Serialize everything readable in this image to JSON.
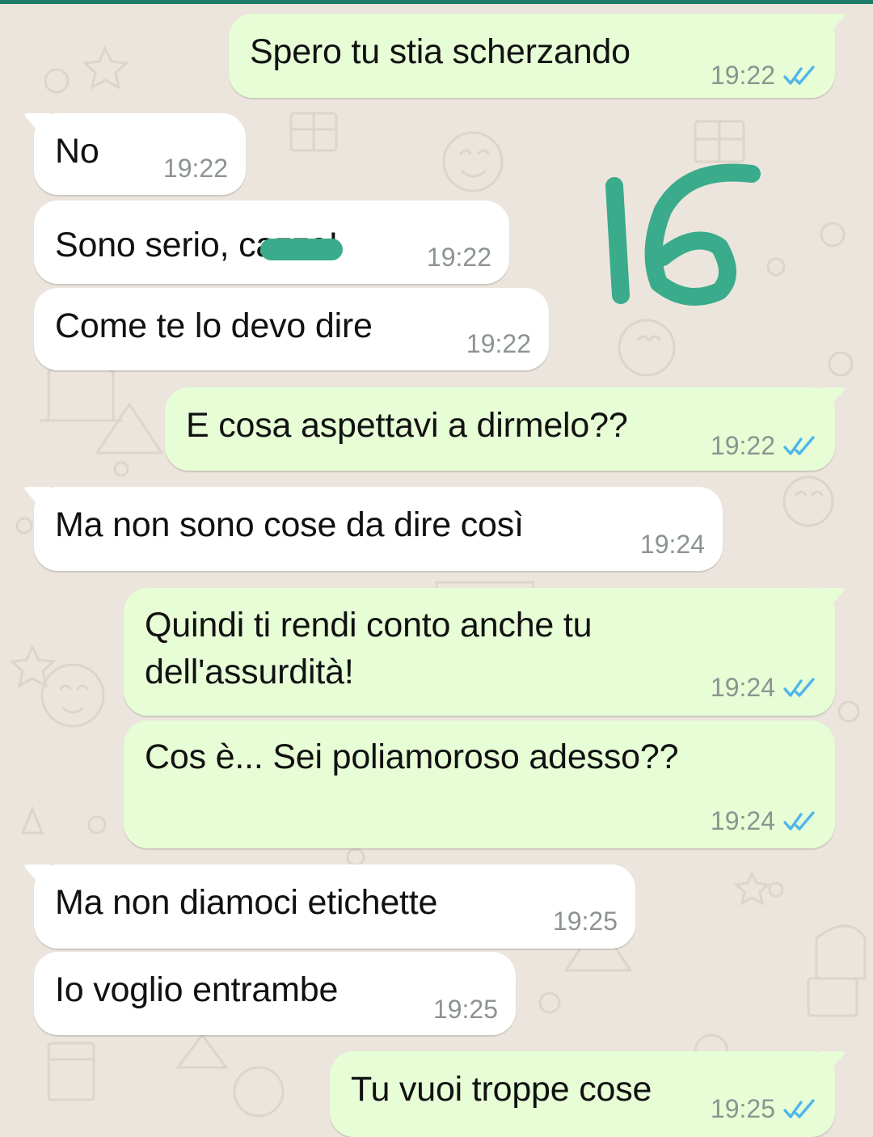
{
  "colors": {
    "background": "#ece5dd",
    "incoming_bubble": "#ffffff",
    "outgoing_bubble": "#e7fdd6",
    "read_ticks": "#4fb6ec",
    "annotation": "#3aab8b"
  },
  "annotation_text": "16",
  "messages": [
    {
      "dir": "out",
      "text": "Spero tu stia scherzando",
      "time": "19:22",
      "status_icon": "double-check-read-icon"
    },
    {
      "dir": "in",
      "text": "No",
      "time": "19:22"
    },
    {
      "dir": "in",
      "text": "Sono serio, cazzo!",
      "time": "19:22"
    },
    {
      "dir": "in",
      "text": "Come te lo devo dire",
      "time": "19:22"
    },
    {
      "dir": "out",
      "text": "E cosa aspettavi a dirmelo??",
      "time": "19:22",
      "status_icon": "double-check-read-icon"
    },
    {
      "dir": "in",
      "text": "Ma non sono cose da dire così",
      "time": "19:24"
    },
    {
      "dir": "out",
      "text": "Quindi ti rendi conto anche tu\ndell'assurdità!",
      "time": "19:24",
      "status_icon": "double-check-read-icon"
    },
    {
      "dir": "out",
      "text": "Cos è... Sei poliamoroso adesso??",
      "time": "19:24",
      "status_icon": "double-check-read-icon"
    },
    {
      "dir": "in",
      "text": "Ma non diamoci etichette",
      "time": "19:25"
    },
    {
      "dir": "in",
      "text": "Io voglio entrambe",
      "time": "19:25"
    },
    {
      "dir": "out",
      "text": "Tu vuoi troppe cose",
      "time": "19:25",
      "status_icon": "double-check-read-icon"
    }
  ]
}
